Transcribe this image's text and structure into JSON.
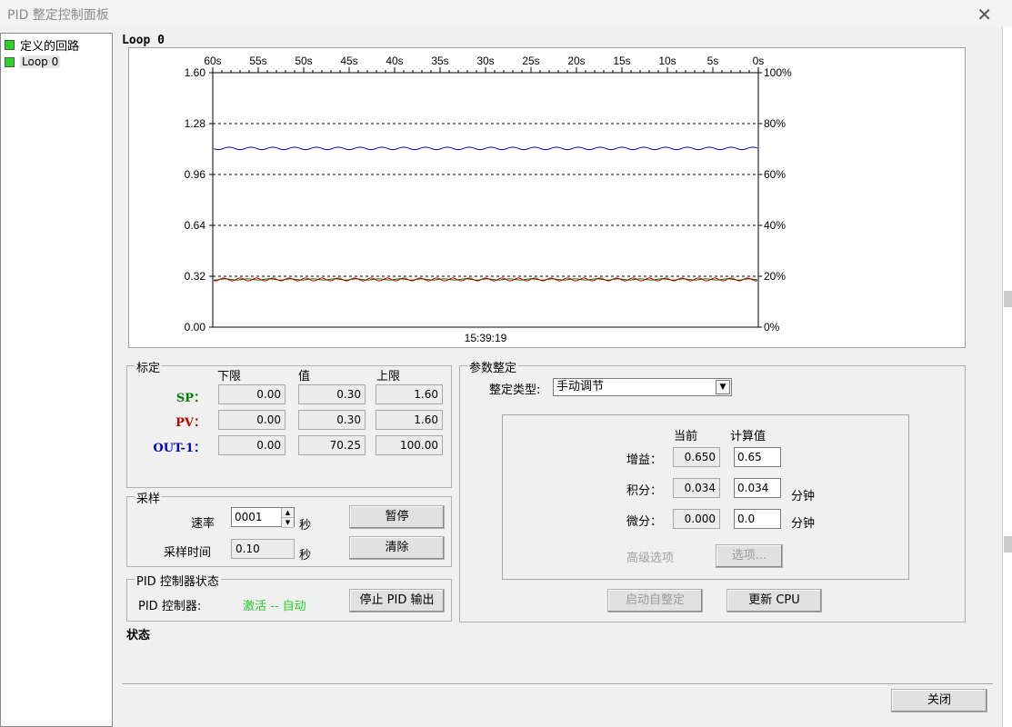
{
  "window": {
    "title": "PID 整定控制面板"
  },
  "tree": {
    "items": [
      {
        "label": "定义的回路"
      },
      {
        "label": "Loop 0"
      }
    ]
  },
  "loop_label": "Loop 0",
  "chart_data": {
    "type": "line",
    "x_ticks": [
      "60s",
      "55s",
      "50s",
      "45s",
      "40s",
      "35s",
      "30s",
      "25s",
      "20s",
      "15s",
      "10s",
      "5s",
      "0s"
    ],
    "y_left_ticks": [
      "1.60",
      "1.28",
      "0.96",
      "0.64",
      "0.32",
      "0.00"
    ],
    "y_right_ticks": [
      "100%",
      "80%",
      "60%",
      "40%",
      "20%",
      "0%"
    ],
    "ylim_left": [
      0,
      1.6
    ],
    "ylim_right": [
      0,
      100
    ],
    "timestamp": "15:39:19",
    "grid": "horizontal dashed",
    "series": [
      {
        "color": "#0000c0",
        "mean_percent": 70.25
      },
      {
        "color": "#007000",
        "mean": 0.3
      },
      {
        "color": "#c00000",
        "mean": 0.3
      }
    ]
  },
  "calibration": {
    "title": "标定",
    "headers": {
      "low": "下限",
      "value": "值",
      "high": "上限"
    },
    "rows": [
      {
        "label": "SP：",
        "color": "#008000",
        "low": "0.00",
        "value": "0.30",
        "high": "1.60"
      },
      {
        "label": "PV：",
        "color": "#c00000",
        "low": "0.00",
        "value": "0.30",
        "high": "1.60"
      },
      {
        "label": "OUT-1：",
        "color": "#0000c0",
        "low": "0.00",
        "value": "70.25",
        "high": "100.00"
      }
    ]
  },
  "sampling": {
    "title": "采样",
    "rate_label": "速率",
    "rate_value": "0001",
    "sec_label": "秒",
    "time_label": "采样时间",
    "time_value": "0.10",
    "pause_button": "暂停",
    "clear_button": "清除"
  },
  "controller": {
    "title": "PID 控制器状态",
    "label": "PID 控制器:",
    "status": "激活 -- 自动",
    "status_color": "#22cc22",
    "stop_button": "停止 PID 输出"
  },
  "status_label": "状态",
  "tuning": {
    "title": "参数整定",
    "type_label": "整定类型:",
    "type_value": "手动调节",
    "headers": {
      "current": "当前",
      "calc": "计算值"
    },
    "gain": {
      "label": "增益：",
      "current": "0.650",
      "calc": "0.65"
    },
    "integral": {
      "label": "积分：",
      "current": "0.034",
      "calc": "0.034",
      "unit": "分钟"
    },
    "derivative": {
      "label": "微分：",
      "current": "0.000",
      "calc": "0.0",
      "unit": "分钟"
    },
    "advanced_label": "高级选项",
    "options_button": "选项...",
    "auto_tune_button": "启动自整定",
    "update_cpu_button": "更新 CPU"
  },
  "footer": {
    "close_button": "关闭"
  }
}
